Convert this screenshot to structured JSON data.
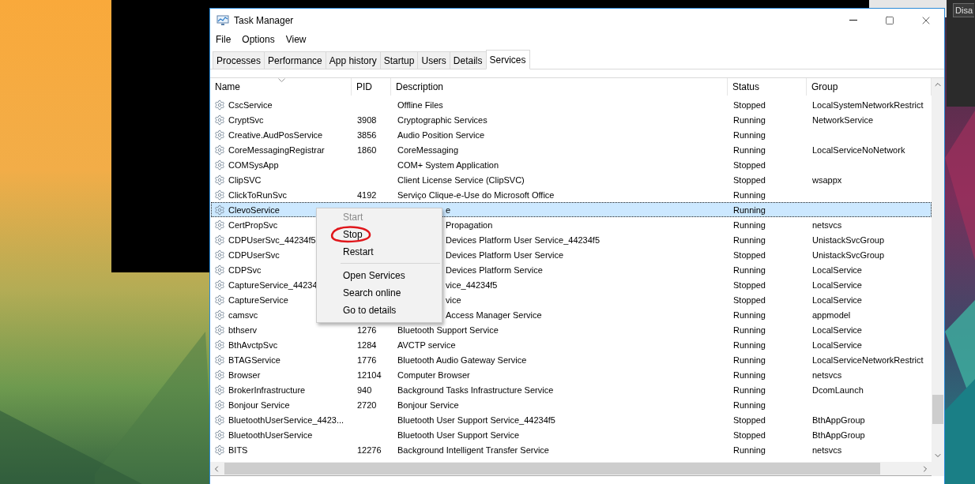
{
  "desktop": {
    "other_window_button": "Disa"
  },
  "window": {
    "title": "Task Manager"
  },
  "menu_bar": [
    "File",
    "Options",
    "View"
  ],
  "tabs": [
    {
      "label": "Processes",
      "selected": false
    },
    {
      "label": "Performance",
      "selected": false
    },
    {
      "label": "App history",
      "selected": false
    },
    {
      "label": "Startup",
      "selected": false
    },
    {
      "label": "Users",
      "selected": false
    },
    {
      "label": "Details",
      "selected": false
    },
    {
      "label": "Services",
      "selected": true
    }
  ],
  "table": {
    "columns": [
      {
        "label": "Name",
        "sorted": true
      },
      {
        "label": "PID",
        "sorted": false
      },
      {
        "label": "Description",
        "sorted": false
      },
      {
        "label": "Status",
        "sorted": false
      },
      {
        "label": "Group",
        "sorted": false
      }
    ],
    "rows": [
      {
        "name": "CscService",
        "description": "Offline Files",
        "status": "Stopped",
        "group": "LocalSystemNetworkRestrict",
        "selected": false
      },
      {
        "name": "CryptSvc",
        "pid": "3908",
        "description": "Cryptographic Services",
        "status": "Running",
        "group": "NetworkService",
        "selected": false
      },
      {
        "name": "Creative.AudPosService",
        "pid": "3856",
        "description": "Audio Position Service",
        "status": "Running",
        "selected": false
      },
      {
        "name": "CoreMessagingRegistrar",
        "pid": "1860",
        "description": "CoreMessaging",
        "status": "Running",
        "group": "LocalServiceNoNetwork",
        "selected": false
      },
      {
        "name": "COMSysApp",
        "description": "COM+ System Application",
        "status": "Stopped",
        "selected": false
      },
      {
        "name": "ClipSVC",
        "description": "Client License Service (ClipSVC)",
        "status": "Stopped",
        "group": "wsappx",
        "selected": false
      },
      {
        "name": "ClickToRunSvc",
        "pid": "4192",
        "description": "Serviço Clique-e-Use do Microsoft Office",
        "status": "Running",
        "selected": false
      },
      {
        "name": "ClevoService",
        "description": "e",
        "description_clipped": true,
        "status": "Running",
        "selected": true
      },
      {
        "name": "CertPropSvc",
        "description": "Propagation",
        "description_clipped": true,
        "status": "Running",
        "group": "netsvcs",
        "selected": false
      },
      {
        "name": "CDPUserSvc_44234f5",
        "description": "Devices Platform User Service_44234f5",
        "description_clipped": true,
        "status": "Running",
        "group": "UnistackSvcGroup",
        "selected": false
      },
      {
        "name": "CDPUserSvc",
        "description": "Devices Platform User Service",
        "description_clipped": true,
        "status": "Stopped",
        "group": "UnistackSvcGroup",
        "selected": false
      },
      {
        "name": "CDPSvc",
        "description": "Devices Platform Service",
        "description_clipped": true,
        "status": "Running",
        "group": "LocalService",
        "selected": false
      },
      {
        "name": "CaptureService_44234",
        "description": "vice_44234f5",
        "description_clipped": true,
        "status": "Stopped",
        "group": "LocalService",
        "selected": false
      },
      {
        "name": "CaptureService",
        "description": "vice",
        "description_clipped": true,
        "status": "Stopped",
        "group": "LocalService",
        "selected": false
      },
      {
        "name": "camsvc",
        "description": "Access Manager Service",
        "description_clipped": true,
        "status": "Running",
        "group": "appmodel",
        "selected": false
      },
      {
        "name": "bthserv",
        "pid": "1276",
        "description": "Bluetooth Support Service",
        "status": "Running",
        "group": "LocalService",
        "selected": false
      },
      {
        "name": "BthAvctpSvc",
        "pid": "1284",
        "description": "AVCTP service",
        "status": "Running",
        "group": "LocalService",
        "selected": false
      },
      {
        "name": "BTAGService",
        "pid": "1776",
        "description": "Bluetooth Audio Gateway Service",
        "status": "Running",
        "group": "LocalServiceNetworkRestrict",
        "selected": false
      },
      {
        "name": "Browser",
        "pid": "12104",
        "description": "Computer Browser",
        "status": "Running",
        "group": "netsvcs",
        "selected": false
      },
      {
        "name": "BrokerInfrastructure",
        "pid": "940",
        "description": "Background Tasks Infrastructure Service",
        "status": "Running",
        "group": "DcomLaunch",
        "selected": false
      },
      {
        "name": "Bonjour Service",
        "pid": "2720",
        "description": "Bonjour Service",
        "status": "Running",
        "selected": false
      },
      {
        "name": "BluetoothUserService_4423...",
        "description": "Bluetooth User Support Service_44234f5",
        "status": "Stopped",
        "group": "BthAppGroup",
        "selected": false
      },
      {
        "name": "BluetoothUserService",
        "description": "Bluetooth User Support Service",
        "status": "Stopped",
        "group": "BthAppGroup",
        "selected": false
      },
      {
        "name": "BITS",
        "pid": "12276",
        "description": "Background Intelligent Transfer Service",
        "status": "Running",
        "group": "netsvcs",
        "selected": false
      }
    ]
  },
  "context_menu": [
    {
      "kind": "item",
      "label": "Start",
      "disabled": true,
      "circled": false
    },
    {
      "kind": "item",
      "label": "Stop",
      "disabled": false,
      "circled": true
    },
    {
      "kind": "item",
      "label": "Restart",
      "disabled": false,
      "circled": false
    },
    {
      "kind": "separator"
    },
    {
      "kind": "item",
      "label": "Open Services",
      "disabled": false,
      "circled": false
    },
    {
      "kind": "item",
      "label": "Search online",
      "disabled": false,
      "circled": false
    },
    {
      "kind": "item",
      "label": "Go to details",
      "disabled": false,
      "circled": false
    }
  ]
}
